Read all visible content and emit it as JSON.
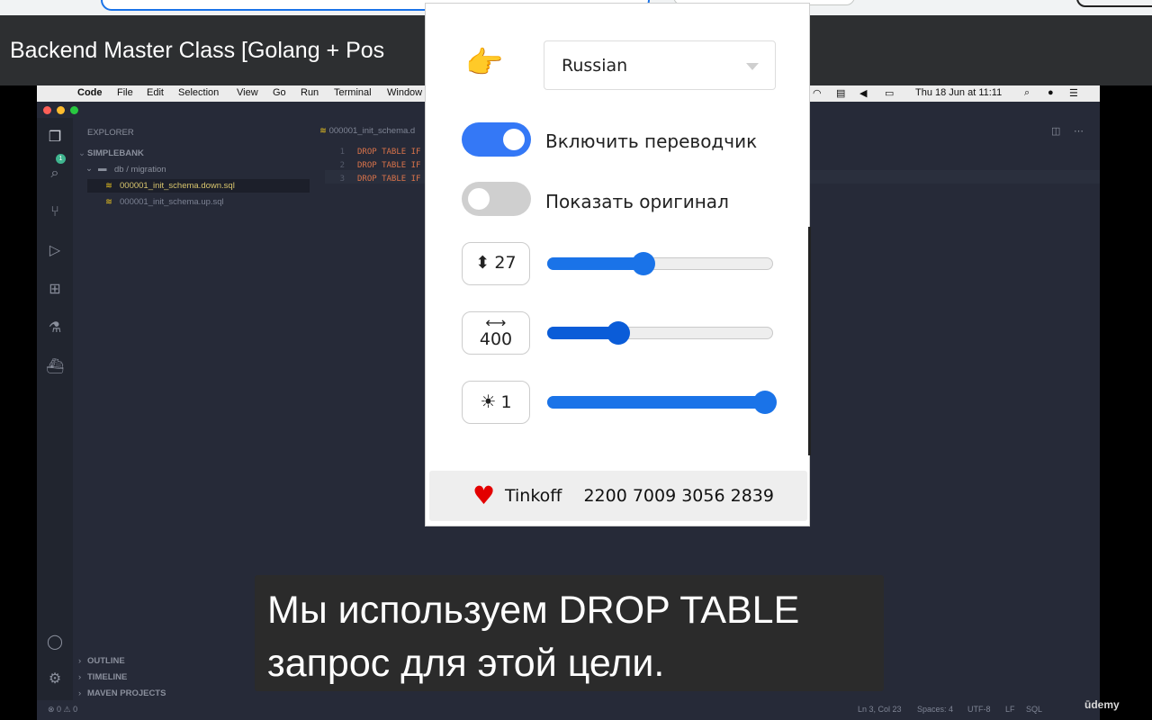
{
  "page": {
    "course_title": "Backend Master Class [Golang + Pos",
    "subtitle_line1": "Мы используем DROP TABLE",
    "subtitle_line2": "запрос для этой цели.",
    "watermark": "ūdemy"
  },
  "mac_menu": {
    "items": [
      "Code",
      "File",
      "Edit",
      "Selection",
      "View",
      "Go",
      "Run",
      "Terminal",
      "Window"
    ],
    "clock": "Thu 18 Jun at  11:11"
  },
  "vscode": {
    "explorer_title": "EXPLORER",
    "project": "SIMPLEBANK",
    "folder": "db / migration",
    "files": [
      "000001_init_schema.down.sql",
      "000001_init_schema.up.sql"
    ],
    "tab": "000001_init_schema.d",
    "code_lines": [
      {
        "n": "1",
        "text": "DROP TABLE IF"
      },
      {
        "n": "2",
        "text": "DROP TABLE IF"
      },
      {
        "n": "3",
        "text": "DROP TABLE IF"
      }
    ],
    "panels": [
      "OUTLINE",
      "TIMELINE",
      "MAVEN PROJECTS"
    ],
    "status_left": "⊗ 0  ⚠ 0",
    "status_right": {
      "position": "Ln 3, Col 23",
      "spaces": "Spaces: 4",
      "encoding": "UTF-8",
      "eol": "LF",
      "lang": "SQL"
    },
    "notification_count": "1"
  },
  "popup": {
    "language": "Russian",
    "toggles": [
      {
        "label": "Включить переводчик",
        "on": true
      },
      {
        "label": "Показать оригинал",
        "on": false
      }
    ],
    "controls": [
      {
        "icon": "vertical-resize-icon",
        "glyph": "⬍",
        "value": "27",
        "fraction": 0.42,
        "color": "#1a73e8"
      },
      {
        "icon": "horizontal-resize-icon",
        "glyph": "⟷",
        "value": "400",
        "fraction": 0.3,
        "color": "#0a5cd8"
      },
      {
        "icon": "brightness-icon",
        "glyph": "☀",
        "value": "1",
        "fraction": 1.0,
        "color": "#1a73e8"
      }
    ],
    "donation": {
      "bank": "Tinkoff",
      "card": "2200 7009 3056 2839"
    }
  },
  "colors": {
    "accent": "#3478f6",
    "toggle_off": "#cfcfcf",
    "heart": "#e30000"
  }
}
